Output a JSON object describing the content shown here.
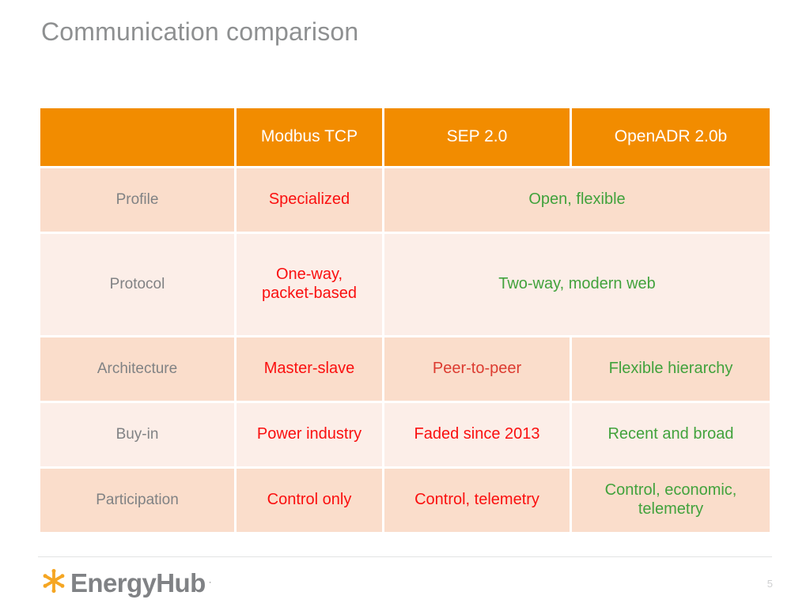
{
  "slide": {
    "title": "Communication comparison",
    "page_number": "5"
  },
  "logo": {
    "mark": "asterisk-burst-icon",
    "word": "EnergyHub",
    "trademark": "·"
  },
  "colors": {
    "header_orange": "#F28C00",
    "row_dark": "#FADDCB",
    "row_light": "#FCEEE8",
    "label_gray": "#808284",
    "negative_red": "#FA0F0F",
    "negative_red_muted": "#DC3B30",
    "positive_green": "#41A23C",
    "title_gray": "#8E9091"
  },
  "table": {
    "headers": [
      "",
      "Modbus TCP",
      "SEP 2.0",
      "OpenADR 2.0b"
    ],
    "rows": [
      {
        "label": "Profile",
        "modbus": "Specialized",
        "merged": true,
        "merged_value": "Open, flexible"
      },
      {
        "label": "Protocol",
        "modbus": "One-way,\npacket-based",
        "modbus_line1": "One-way,",
        "modbus_line2": "packet-based",
        "merged": true,
        "merged_value": "Two-way, modern web"
      },
      {
        "label": "Architecture",
        "modbus": "Master-slave",
        "merged": false,
        "sep": "Peer-to-peer",
        "openadr": "Flexible hierarchy"
      },
      {
        "label": "Buy-in",
        "modbus": "Power industry",
        "merged": false,
        "sep": "Faded since 2013",
        "openadr": "Recent and broad"
      },
      {
        "label": "Participation",
        "modbus": "Control only",
        "merged": false,
        "sep": "Control, telemetry",
        "openadr_line1": "Control, economic,",
        "openadr_line2": "telemetry"
      }
    ]
  }
}
